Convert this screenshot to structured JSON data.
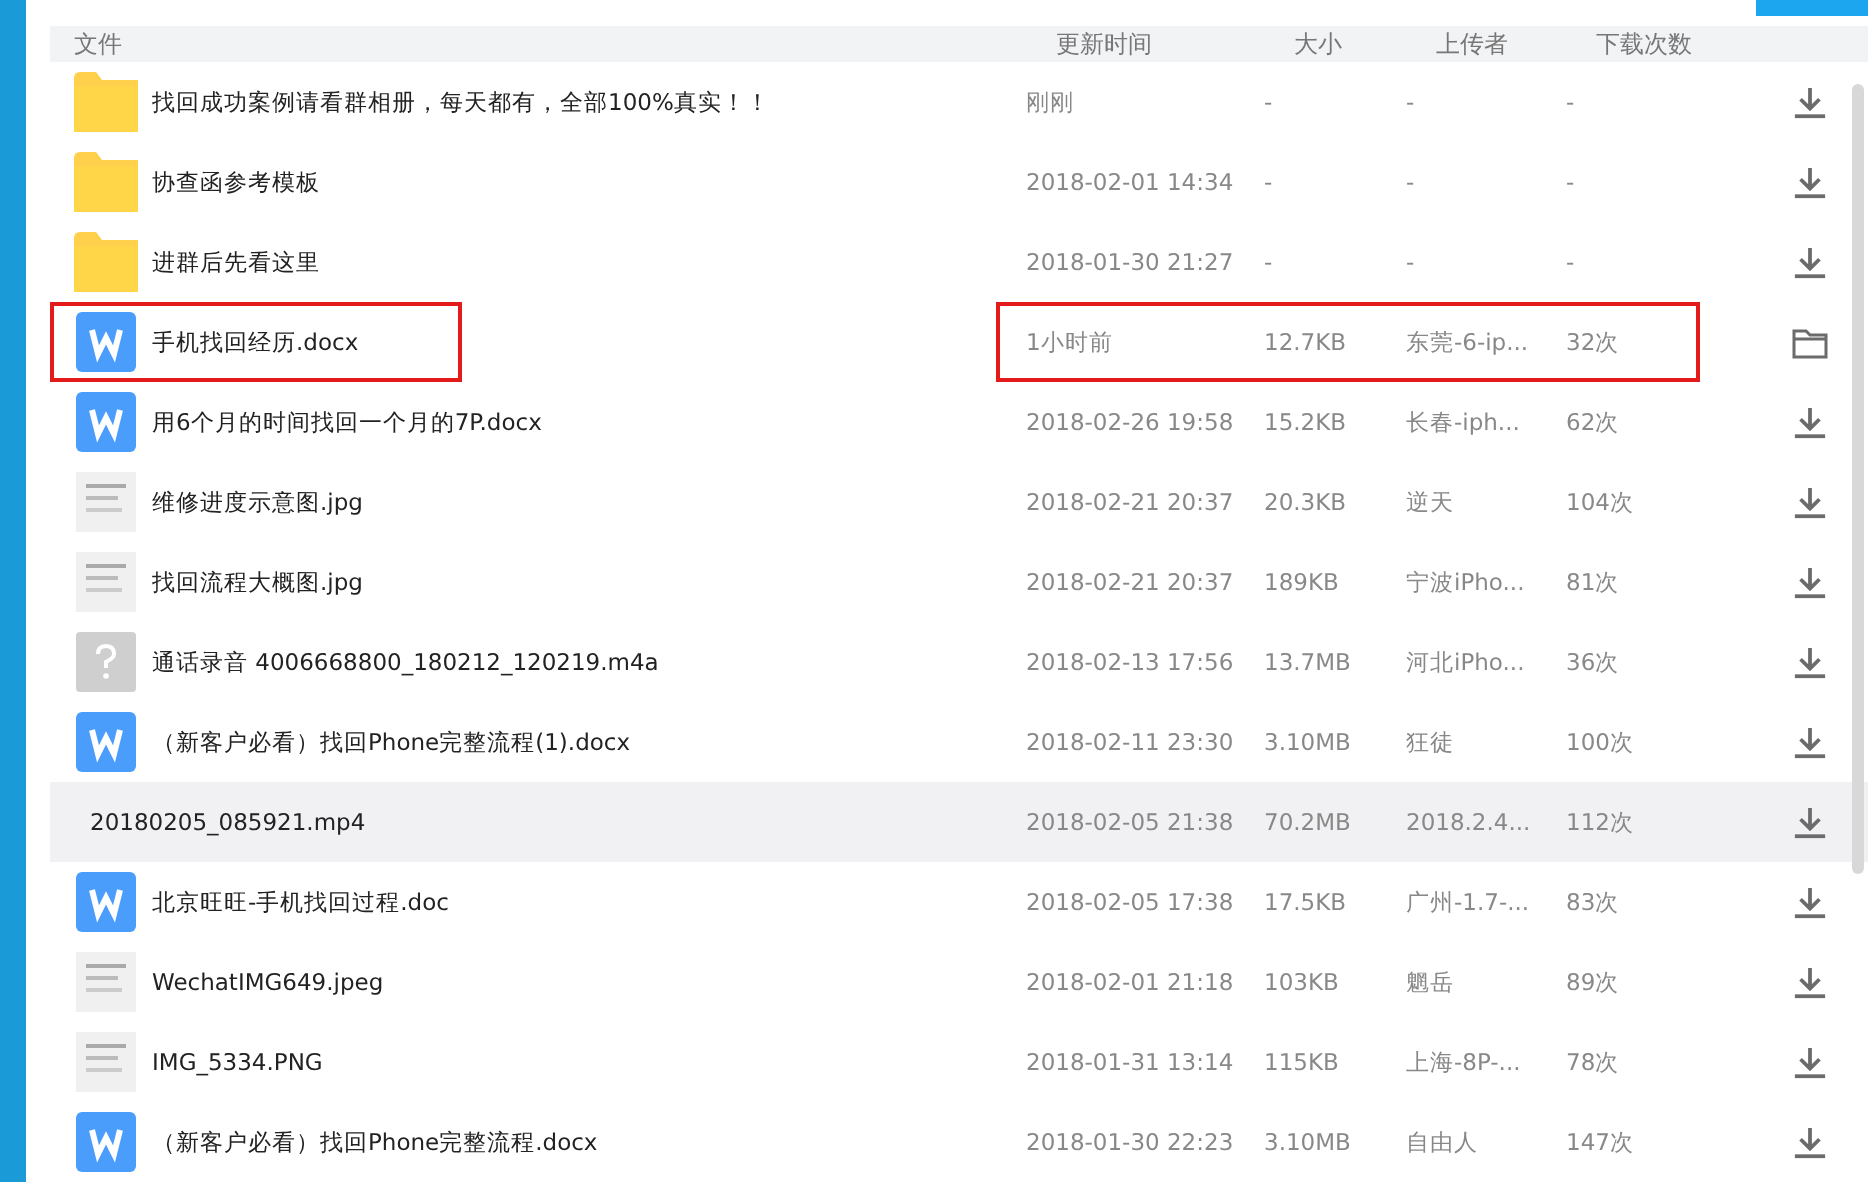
{
  "columns": [
    "文件",
    "更新时间",
    "大小",
    "上传者",
    "下载次数"
  ],
  "rows": [
    {
      "kind": "folder",
      "name": "找回成功案例请看群相册，每天都有，全部100%真实！！",
      "time": "刚刚",
      "size": "-",
      "uploader": "-",
      "count": "-",
      "action": {
        "kind": "download"
      },
      "selected": false,
      "marked": false
    },
    {
      "kind": "folder",
      "name": "协查函参考模板",
      "time": "2018-02-01 14:34",
      "size": "-",
      "uploader": "-",
      "count": "-",
      "action": {
        "kind": "download"
      },
      "selected": false,
      "marked": false
    },
    {
      "kind": "folder",
      "name": "进群后先看这里",
      "time": "2018-01-30 21:27",
      "size": "-",
      "uploader": "-",
      "count": "-",
      "action": {
        "kind": "download"
      },
      "selected": false,
      "marked": false
    },
    {
      "kind": "word",
      "name": "手机找回经历.docx",
      "time": "1小时前",
      "size": "12.7KB",
      "uploader": "东莞-6-ip...",
      "count": "32次",
      "action": {
        "kind": "folder"
      },
      "selected": false,
      "marked": true
    },
    {
      "kind": "word",
      "name": "用6个月的时间找回一个月的7P.docx",
      "time": "2018-02-26 19:58",
      "size": "15.2KB",
      "uploader": "长春-iph...",
      "count": "62次",
      "action": {
        "kind": "download"
      },
      "selected": false,
      "marked": false
    },
    {
      "kind": "image",
      "name": "维修进度示意图.jpg",
      "time": "2018-02-21 20:37",
      "size": "20.3KB",
      "uploader": "逆天",
      "count": "104次",
      "action": {
        "kind": "download"
      },
      "selected": false,
      "marked": false
    },
    {
      "kind": "image",
      "name": "找回流程大概图.jpg",
      "time": "2018-02-21 20:37",
      "size": "189KB",
      "uploader": "宁波iPho...",
      "count": "81次",
      "action": {
        "kind": "download"
      },
      "selected": false,
      "marked": false
    },
    {
      "kind": "unknown",
      "name": "通话录音 4006668800_180212_120219.m4a",
      "time": "2018-02-13 17:56",
      "size": "13.7MB",
      "uploader": "河北iPho...",
      "count": "36次",
      "action": {
        "kind": "download"
      },
      "selected": false,
      "marked": false
    },
    {
      "kind": "word",
      "name": "（新客户必看）找回Phone完整流程(1).docx",
      "time": "2018-02-11 23:30",
      "size": "3.10MB",
      "uploader": "狂徒",
      "count": "100次",
      "action": {
        "kind": "download"
      },
      "selected": false,
      "marked": false
    },
    {
      "kind": "video",
      "name": "20180205_085921.mp4",
      "time": "2018-02-05 21:38",
      "size": "70.2MB",
      "uploader": "2018.2.4...",
      "count": "112次",
      "action": {
        "kind": "download"
      },
      "selected": true,
      "marked": false
    },
    {
      "kind": "word",
      "name": "北京旺旺-手机找回过程.doc",
      "time": "2018-02-05 17:38",
      "size": "17.5KB",
      "uploader": "广州-1.7-...",
      "count": "83次",
      "action": {
        "kind": "download"
      },
      "selected": false,
      "marked": false
    },
    {
      "kind": "image",
      "name": "WechatIMG649.jpeg",
      "time": "2018-02-01 21:18",
      "size": "103KB",
      "uploader": "魍岳",
      "count": "89次",
      "action": {
        "kind": "download"
      },
      "selected": false,
      "marked": false
    },
    {
      "kind": "image",
      "name": "IMG_5334.PNG",
      "time": "2018-01-31 13:14",
      "size": "115KB",
      "uploader": "上海-8P-...",
      "count": "78次",
      "action": {
        "kind": "download"
      },
      "selected": false,
      "marked": false
    },
    {
      "kind": "word",
      "name": "（新客户必看）找回Phone完整流程.docx",
      "time": "2018-01-30 22:23",
      "size": "3.10MB",
      "uploader": "自由人",
      "count": "147次",
      "action": {
        "kind": "download"
      },
      "selected": false,
      "marked": false
    }
  ]
}
